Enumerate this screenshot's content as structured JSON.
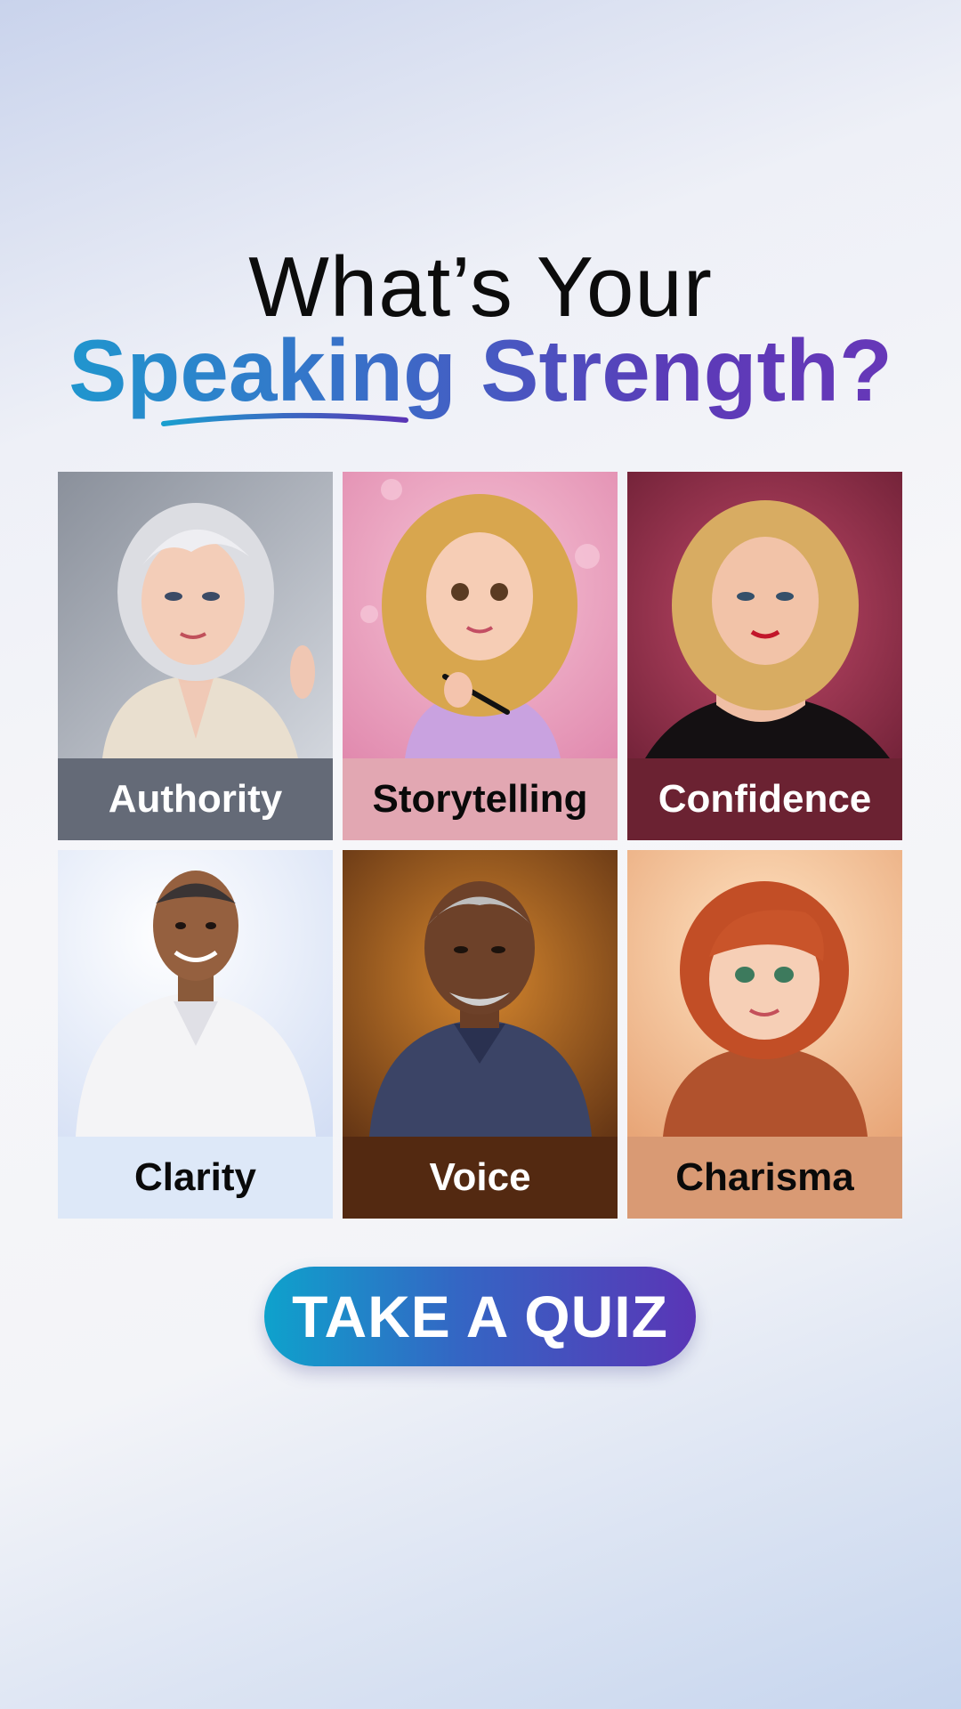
{
  "headline": {
    "line1": "What’s Your",
    "line2": "Speaking Strength?"
  },
  "cards": [
    {
      "label": "Authority",
      "bg": "#9aa0ab",
      "label_bg": "#646a77",
      "label_color": "#ffffff",
      "icon": "woman-silver-hair-portrait"
    },
    {
      "label": "Storytelling",
      "bg": "#e8a3c2",
      "label_bg": "#e2a7b2",
      "label_color": "#0a0a0a",
      "icon": "woman-curly-blonde-pen-portrait"
    },
    {
      "label": "Confidence",
      "bg": "#9c2e4a",
      "label_bg": "#6b2232",
      "label_color": "#ffffff",
      "icon": "woman-blonde-black-dress-portrait"
    },
    {
      "label": "Clarity",
      "bg": "#e8eefa",
      "label_bg": "#dde8f8",
      "label_color": "#0a0a0a",
      "icon": "man-white-shirt-portrait"
    },
    {
      "label": "Voice",
      "bg": "#8c4f1e",
      "label_bg": "#532911",
      "label_color": "#ffffff",
      "icon": "older-man-blue-shirt-portrait"
    },
    {
      "label": "Charisma",
      "bg": "#f2c39a",
      "label_bg": "#d99a74",
      "label_color": "#0a0a0a",
      "icon": "woman-red-hair-sweater-portrait"
    }
  ],
  "cta": {
    "label": "TAKE A QUIZ"
  },
  "colors": {
    "accent_start": "#0ea2cc",
    "accent_end": "#5a35b6"
  }
}
